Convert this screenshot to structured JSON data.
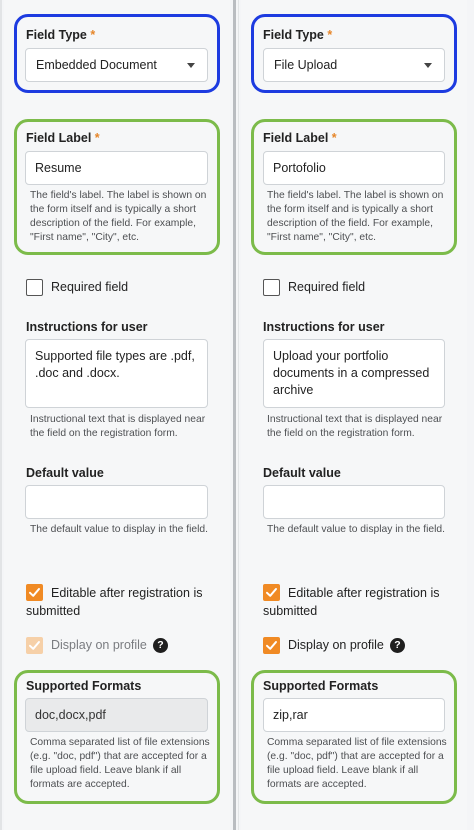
{
  "left": {
    "field_type": {
      "label": "Field Type",
      "required_mark": "*",
      "value": "Embedded Document"
    },
    "field_label": {
      "label": "Field Label",
      "required_mark": "*",
      "value": "Resume",
      "help": "The field's label. The label is shown on the form itself and is typically a short description of the field. For example, \"First name\", \"City\", etc."
    },
    "required_field": {
      "label": "Required field",
      "checked": false
    },
    "instructions": {
      "label": "Instructions for user",
      "value": "Supported file types are .pdf, .doc and .docx.",
      "help": "Instructional text that is displayed near the field on the registration form."
    },
    "default_value": {
      "label": "Default value",
      "value": "",
      "help": "The default value to display in the field."
    },
    "editable": {
      "label": "Editable after registration is submitted",
      "checked": true
    },
    "display_on_profile": {
      "label": "Display on profile",
      "checked": true,
      "disabled": true,
      "icon": "?"
    },
    "supported_formats": {
      "label": "Supported Formats",
      "value": "doc,docx,pdf",
      "disabled": true,
      "help": "Comma separated list of file extensions (e.g. \"doc, pdf\") that are accepted for a file upload field. Leave blank if all formats are accepted."
    }
  },
  "right": {
    "field_type": {
      "label": "Field Type",
      "required_mark": "*",
      "value": "File Upload"
    },
    "field_label": {
      "label": "Field Label",
      "required_mark": "*",
      "value": "Portofolio",
      "help": "The field's label. The label is shown on the form itself and is typically a short description of the field. For example, \"First name\", \"City\", etc."
    },
    "required_field": {
      "label": "Required field",
      "checked": false
    },
    "instructions": {
      "label": "Instructions for user",
      "value": "Upload your portfolio documents in a compressed archive",
      "help": "Instructional text that is displayed near the field on the registration form."
    },
    "default_value": {
      "label": "Default value",
      "value": "",
      "help": "The default value to display in the field."
    },
    "editable": {
      "label": "Editable after registration is submitted",
      "checked": true
    },
    "display_on_profile": {
      "label": "Display on profile",
      "checked": true,
      "disabled": false,
      "icon": "?"
    },
    "supported_formats": {
      "label": "Supported Formats",
      "value": "zip,rar",
      "disabled": false,
      "help": "Comma separated list of file extensions (e.g. \"doc, pdf\") that are accepted for a file upload field. Leave blank if all formats are accepted."
    }
  },
  "colors": {
    "accent": "#f08a24",
    "highlight_blue": "#1d3be0",
    "highlight_green": "#7cbb4a",
    "required": "#e6862a"
  }
}
